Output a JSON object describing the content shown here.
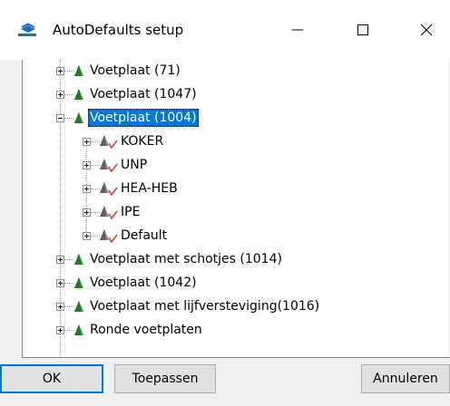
{
  "window": {
    "title": "AutoDefaults setup",
    "icon": "autodefaults-app-icon",
    "controls": [
      "minimize-icon",
      "maximize-icon",
      "close-icon"
    ]
  },
  "tree": {
    "items": [
      {
        "label": "Voetplaat (71)",
        "level": 1,
        "icon": "green-profile-icon",
        "expander": "plus",
        "selected": false
      },
      {
        "label": "Voetplaat (1047)",
        "level": 1,
        "icon": "green-profile-icon",
        "expander": "plus",
        "selected": false
      },
      {
        "label": "Voetplaat (1004)",
        "level": 1,
        "icon": "green-profile-icon",
        "expander": "minus",
        "selected": true
      },
      {
        "label": "KOKER",
        "level": 2,
        "icon": "grey-profile-check-icon",
        "expander": "plus",
        "selected": false
      },
      {
        "label": "UNP",
        "level": 2,
        "icon": "grey-profile-check-icon",
        "expander": "plus",
        "selected": false
      },
      {
        "label": "HEA-HEB",
        "level": 2,
        "icon": "grey-profile-check-icon",
        "expander": "plus",
        "selected": false
      },
      {
        "label": "IPE",
        "level": 2,
        "icon": "grey-profile-check-icon",
        "expander": "plus",
        "selected": false
      },
      {
        "label": "Default",
        "level": 2,
        "icon": "grey-profile-check-icon",
        "expander": "plus",
        "selected": false
      },
      {
        "label": "Voetplaat met schotjes (1014)",
        "level": 1,
        "icon": "green-profile-icon",
        "expander": "plus",
        "selected": false
      },
      {
        "label": "Voetplaat (1042)",
        "level": 1,
        "icon": "green-profile-icon",
        "expander": "plus",
        "selected": false
      },
      {
        "label": "Voetplaat met lijfversteviging(1016)",
        "level": 1,
        "icon": "green-profile-icon",
        "expander": "plus",
        "selected": false
      },
      {
        "label": "Ronde voetplaten",
        "level": 1,
        "icon": "green-profile-icon",
        "expander": "plus",
        "selected": false
      }
    ]
  },
  "buttons": {
    "ok": "OK",
    "apply": "Toepassen",
    "cancel": "Annuleren"
  },
  "colors": {
    "selection": "#0078d7",
    "green_icon": "#2e9e2e",
    "red_check": "#e03a2a"
  }
}
